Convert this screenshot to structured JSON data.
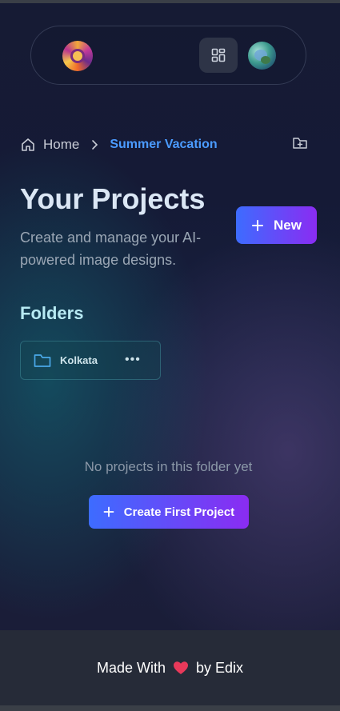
{
  "navbar": {
    "logo_icon": "swirl-logo-icon",
    "grid_icon": "dashboard-grid-icon",
    "avatar_icon": "user-avatar-icon"
  },
  "breadcrumb": {
    "home_label": "Home",
    "current_label": "Summer Vacation",
    "home_icon": "home-icon",
    "separator_icon": "chevron-right-icon"
  },
  "header": {
    "title": "Your Projects",
    "subtitle": "Create and manage your AI-powered image designs.",
    "new_button_label": "New",
    "folder_add_icon": "folder-plus-icon"
  },
  "folders": {
    "heading": "Folders",
    "items": [
      {
        "name": "Kolkata",
        "icon": "folder-icon",
        "menu_icon": "more-horizontal-icon"
      }
    ]
  },
  "empty_state": {
    "message": "No projects in this folder yet",
    "button_label": "Create First Project"
  },
  "footer": {
    "prefix": "Made With",
    "suffix": "by Edix",
    "heart_icon": "heart-icon"
  },
  "colors": {
    "accent_blue": "#4b9bff",
    "gradient_start": "#3d6cff",
    "gradient_end": "#8a2cf2",
    "heart": "#e8395a"
  }
}
